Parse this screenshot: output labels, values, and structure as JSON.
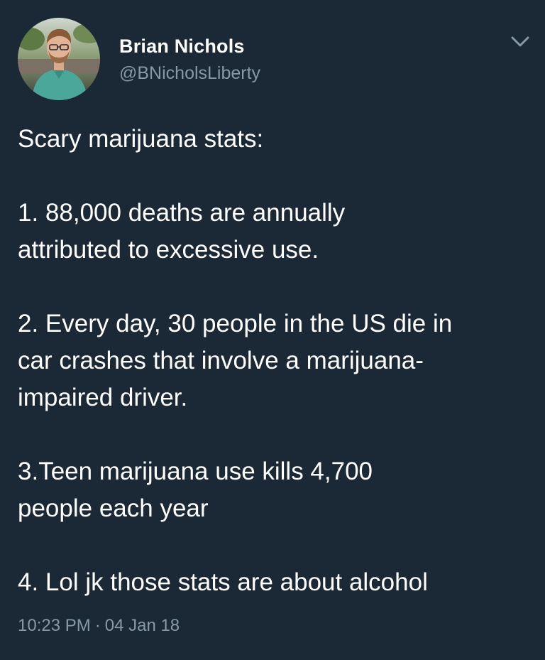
{
  "author": {
    "display_name": "Brian Nichols",
    "handle": "@BNicholsLiberty"
  },
  "menu": {
    "icon": "chevron-down-icon"
  },
  "tweet": {
    "paragraphs": [
      [
        "Scary marijuana stats:"
      ],
      [
        "1. 88,000 deaths are annually",
        "attributed to excessive use."
      ],
      [
        "2. Every day, 30 people in the US die in",
        "car crashes that involve a marijuana-",
        "impaired driver."
      ],
      [
        "3.Teen marijuana use kills 4,700",
        "people each year"
      ],
      [
        "4. Lol jk those stats are about alcohol"
      ]
    ]
  },
  "meta": {
    "time": "10:23 PM",
    "separator": "·",
    "date": "04 Jan 18"
  },
  "colors": {
    "background": "#1b2836",
    "text_primary": "#ffffff",
    "text_secondary": "#8899a6"
  }
}
